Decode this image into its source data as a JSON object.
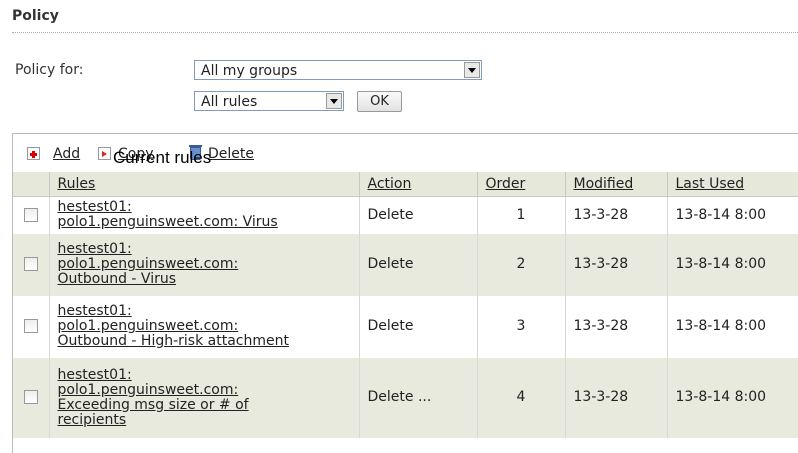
{
  "page": {
    "section_title": "Policy",
    "policy_for_label": "Policy for:",
    "group_select": {
      "value": "All my groups"
    },
    "rules_select": {
      "value": "All rules"
    },
    "ok_label": "OK"
  },
  "toolbar": {
    "add_label": "Add",
    "copy_label": "Copy",
    "delete_label": "Delete",
    "caption": "Current rules"
  },
  "table": {
    "columns": {
      "rules": "Rules",
      "action": "Action",
      "order": "Order",
      "modified": "Modified",
      "last_used": "Last Used"
    },
    "rows": [
      {
        "rule_lines": [
          "hestest01:",
          "polo1.penguinsweet.com: Virus"
        ],
        "action": "Delete",
        "order": "1",
        "modified": "13-3-28",
        "last_used": "13-8-14 8:00"
      },
      {
        "rule_lines": [
          "hestest01:",
          "polo1.penguinsweet.com:",
          "Outbound - Virus"
        ],
        "action": "Delete",
        "order": "2",
        "modified": "13-3-28",
        "last_used": "13-8-14 8:00"
      },
      {
        "rule_lines": [
          "hestest01:",
          "polo1.penguinsweet.com:",
          "Outbound - High-risk attachment"
        ],
        "action": "Delete",
        "order": "3",
        "modified": "13-3-28",
        "last_used": "13-8-14 8:00"
      },
      {
        "rule_lines": [
          "hestest01:",
          "polo1.penguinsweet.com:",
          "Exceeding msg size or # of",
          "recipients"
        ],
        "action": "Delete ...",
        "order": "4",
        "modified": "13-3-28",
        "last_used": "13-8-14 8:00"
      }
    ]
  }
}
